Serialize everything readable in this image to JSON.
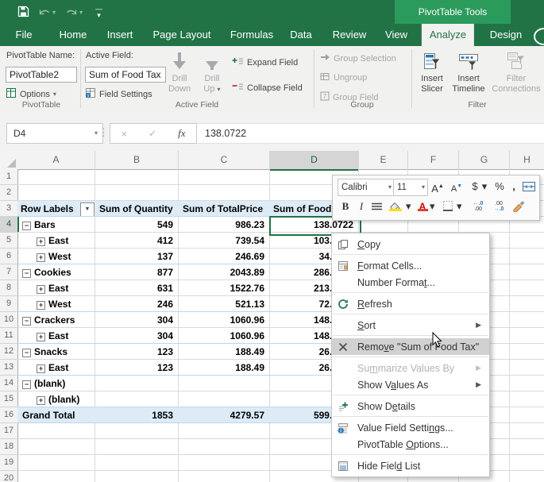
{
  "colors": {
    "excel_green": "#217346",
    "contextual_tab_green": "#2b9b5c",
    "pivot_fill_blue": "#ddebf7",
    "pivot_border_blue": "#bdd7ee",
    "selection_green": "#217346",
    "menu_highlight_gray": "#d1d1d1",
    "fill_color_swatch": "#ffe100",
    "font_color_swatch": "#e03c31"
  },
  "titlebar": {
    "contextual_label": "PivotTable Tools"
  },
  "tabs": {
    "items": [
      "File",
      "Home",
      "Insert",
      "Page Layout",
      "Formulas",
      "Data",
      "Review",
      "View",
      "Analyze",
      "Design"
    ],
    "selected": "Analyze"
  },
  "ribbon": {
    "pivottable_group": {
      "title": "PivotTable",
      "name_label": "PivotTable Name:",
      "name_value": "PivotTable2",
      "options_label": "Options"
    },
    "active_field_group": {
      "title": "Active Field",
      "label": "Active Field:",
      "value": "Sum of Food Tax",
      "field_settings": "Field Settings",
      "drill_down_line1": "Drill",
      "drill_down_line2": "Down",
      "drill_up_line1": "Drill",
      "drill_up_line2": "Up",
      "expand_field": "Expand Field",
      "collapse_field": "Collapse Field"
    },
    "group_group": {
      "title": "Group",
      "items": [
        "Group Selection",
        "Ungroup",
        "Group Field"
      ]
    },
    "filter_group": {
      "title": "Filter",
      "insert_slicer_line1": "Insert",
      "insert_slicer_line2": "Slicer",
      "insert_timeline_line1": "Insert",
      "insert_timeline_line2": "Timeline",
      "filter_connections_line1": "Filter",
      "filter_connections_line2": "Connections"
    }
  },
  "formula_bar": {
    "name_box": "D4",
    "fx_label": "fx",
    "value": "138.0722"
  },
  "grid": {
    "col_headers": [
      "A",
      "B",
      "C",
      "D",
      "E",
      "F",
      "G",
      "H"
    ],
    "selected_col": "D",
    "selected_row": 4,
    "row_count": 20
  },
  "pivot": {
    "header": {
      "row_labels": "Row Labels",
      "col_quantity": "Sum of Quantity",
      "col_totalprice": "Sum of TotalPrice",
      "col_foodtax": "Sum of Food Tax"
    },
    "rows": [
      {
        "row": 4,
        "label": "Bars",
        "level": 0,
        "glyph": "-",
        "qty": "549",
        "total": "986.23",
        "tax": "138.0722"
      },
      {
        "row": 5,
        "label": "East",
        "level": 1,
        "glyph": "+",
        "qty": "412",
        "total": "739.54",
        "tax": "103.5356"
      },
      {
        "row": 6,
        "label": "West",
        "level": 1,
        "glyph": "+",
        "qty": "137",
        "total": "246.69",
        "tax": "34.5366"
      },
      {
        "row": 7,
        "label": "Cookies",
        "level": 0,
        "glyph": "-",
        "qty": "877",
        "total": "2043.89",
        "tax": "286.1446"
      },
      {
        "row": 8,
        "label": "East",
        "level": 1,
        "glyph": "+",
        "qty": "631",
        "total": "1522.76",
        "tax": "213.1864"
      },
      {
        "row": 9,
        "label": "West",
        "level": 1,
        "glyph": "+",
        "qty": "246",
        "total": "521.13",
        "tax": "72.9582"
      },
      {
        "row": 10,
        "label": "Crackers",
        "level": 0,
        "glyph": "-",
        "qty": "304",
        "total": "1060.96",
        "tax": "148.5344"
      },
      {
        "row": 11,
        "label": "East",
        "level": 1,
        "glyph": "+",
        "qty": "304",
        "total": "1060.96",
        "tax": "148.5344"
      },
      {
        "row": 12,
        "label": "Snacks",
        "level": 0,
        "glyph": "-",
        "qty": "123",
        "total": "188.49",
        "tax": "26.3886"
      },
      {
        "row": 13,
        "label": "East",
        "level": 1,
        "glyph": "+",
        "qty": "123",
        "total": "188.49",
        "tax": "26.3886"
      },
      {
        "row": 14,
        "label": "(blank)",
        "level": 0,
        "glyph": "-",
        "qty": "",
        "total": "",
        "tax": ""
      },
      {
        "row": 15,
        "label": "(blank)",
        "level": 1,
        "glyph": "+",
        "qty": "",
        "total": "",
        "tax": ""
      },
      {
        "row": 16,
        "label": "Grand Total",
        "level": 0,
        "glyph": "",
        "qty": "1853",
        "total": "4279.57",
        "tax": "599.1398",
        "total_row": true
      }
    ]
  },
  "mini_toolbar": {
    "font_name": "Calibri",
    "font_size": "11",
    "grow_font": "A",
    "shrink_font": "A",
    "dollar": "$",
    "percent": "%",
    "comma": ",",
    "bold": "B",
    "italic": "I",
    "inc_decimal_top": "←.0",
    "inc_decimal_bottom": ".00",
    "dec_decimal_top": ".00",
    "dec_decimal_bottom": "→.0"
  },
  "context_menu": {
    "items": [
      {
        "label": "Copy",
        "accel": 0,
        "icon": "copy",
        "submenu": false,
        "disabled": false,
        "highlighted": false,
        "sep_after": true
      },
      {
        "label": "Format Cells...",
        "accel": 0,
        "icon": "format-cells",
        "submenu": false,
        "disabled": false,
        "highlighted": false,
        "sep_after": false
      },
      {
        "label": "Number Format...",
        "accel": 12,
        "icon": null,
        "submenu": false,
        "disabled": false,
        "highlighted": false,
        "sep_after": true
      },
      {
        "label": "Refresh",
        "accel": 0,
        "icon": "refresh",
        "submenu": false,
        "disabled": false,
        "highlighted": false,
        "sep_after": true
      },
      {
        "label": "Sort",
        "accel": 0,
        "icon": null,
        "submenu": true,
        "disabled": false,
        "highlighted": false,
        "sep_after": true
      },
      {
        "label": "Remove \"Sum of Food Tax\"",
        "accel": 4,
        "icon": "remove",
        "submenu": false,
        "disabled": false,
        "highlighted": true,
        "sep_after": true
      },
      {
        "label": "Summarize Values By",
        "accel": 2,
        "icon": null,
        "submenu": true,
        "disabled": true,
        "highlighted": false,
        "sep_after": false
      },
      {
        "label": "Show Values As",
        "accel": 6,
        "icon": null,
        "submenu": true,
        "disabled": false,
        "highlighted": false,
        "sep_after": true
      },
      {
        "label": "Show Details",
        "accel": 6,
        "icon": "show-details",
        "submenu": false,
        "disabled": false,
        "highlighted": false,
        "sep_after": true
      },
      {
        "label": "Value Field Settings...",
        "accel": 17,
        "icon": "value-settings",
        "submenu": false,
        "disabled": false,
        "highlighted": false,
        "sep_after": false
      },
      {
        "label": "PivotTable Options...",
        "accel": 11,
        "icon": null,
        "submenu": false,
        "disabled": false,
        "highlighted": false,
        "sep_after": true
      },
      {
        "label": "Hide Field List",
        "accel": 9,
        "icon": "field-list",
        "submenu": false,
        "disabled": false,
        "highlighted": false,
        "sep_after": false
      }
    ]
  }
}
